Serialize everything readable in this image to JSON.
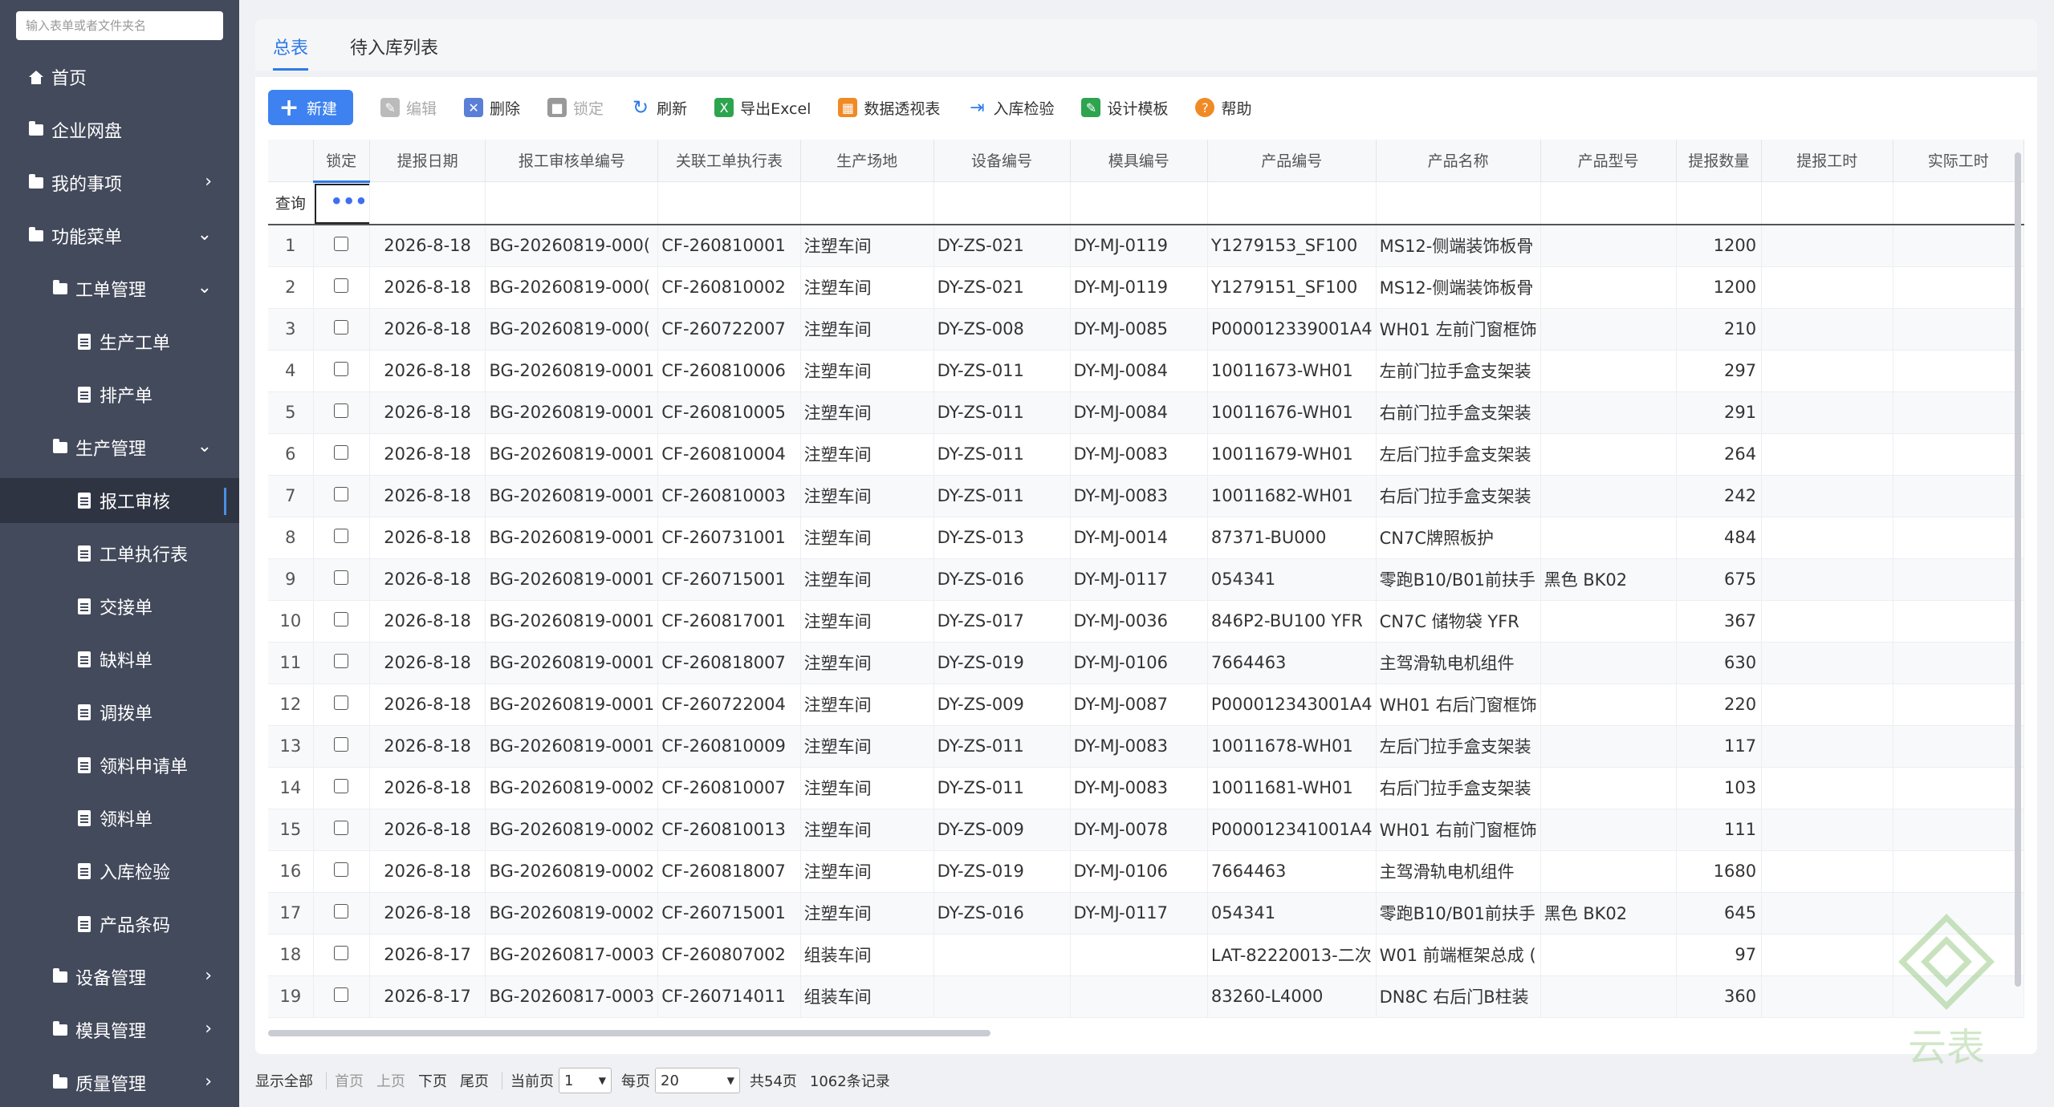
{
  "sidebar": {
    "search_placeholder": "输入表单或者文件夹名",
    "items": [
      {
        "label": "首页"
      },
      {
        "label": "企业网盘"
      },
      {
        "label": "我的事项"
      },
      {
        "label": "功能菜单"
      },
      {
        "label": "工单管理"
      },
      {
        "label": "生产工单"
      },
      {
        "label": "排产单"
      },
      {
        "label": "生产管理"
      },
      {
        "label": "报工审核"
      },
      {
        "label": "工单执行表"
      },
      {
        "label": "交接单"
      },
      {
        "label": "缺料单"
      },
      {
        "label": "调拨单"
      },
      {
        "label": "领料申请单"
      },
      {
        "label": "领料单"
      },
      {
        "label": "入库检验"
      },
      {
        "label": "产品条码"
      },
      {
        "label": "设备管理"
      },
      {
        "label": "模具管理"
      },
      {
        "label": "质量管理"
      }
    ]
  },
  "tabs": [
    {
      "label": "总表"
    },
    {
      "label": "待入库列表"
    }
  ],
  "toolbar": {
    "new": "新建",
    "edit": "编辑",
    "delete": "删除",
    "lock": "锁定",
    "refresh": "刷新",
    "export": "导出Excel",
    "pivot": "数据透视表",
    "inspect": "入库检验",
    "design": "设计模板",
    "help": "帮助"
  },
  "grid": {
    "query_label": "查询",
    "query_dots": "•••",
    "columns": [
      "锁定",
      "提报日期",
      "报工审核单编号",
      "关联工单执行表",
      "生产场地",
      "设备编号",
      "模具编号",
      "产品编号",
      "产品名称",
      "产品型号",
      "提报数量",
      "提报工时",
      "实际工时"
    ],
    "rows": [
      [
        "1",
        "2026-8-18",
        "BG-20260819-000(",
        "CF-260810001",
        "注塑车间",
        "DY-ZS-021",
        "DY-MJ-0119",
        "Y1279153_SF100",
        "MS12-侧端装饰板骨",
        "",
        "1200"
      ],
      [
        "2",
        "2026-8-18",
        "BG-20260819-000(",
        "CF-260810002",
        "注塑车间",
        "DY-ZS-021",
        "DY-MJ-0119",
        "Y1279151_SF100",
        "MS12-侧端装饰板骨",
        "",
        "1200"
      ],
      [
        "3",
        "2026-8-18",
        "BG-20260819-000(",
        "CF-260722007",
        "注塑车间",
        "DY-ZS-008",
        "DY-MJ-0085",
        "P000012339001A4",
        "WH01 左前门窗框饰",
        "",
        "210"
      ],
      [
        "4",
        "2026-8-18",
        "BG-20260819-0001",
        "CF-260810006",
        "注塑车间",
        "DY-ZS-011",
        "DY-MJ-0084",
        "10011673-WH01",
        "左前门拉手盒支架装",
        "",
        "297"
      ],
      [
        "5",
        "2026-8-18",
        "BG-20260819-0001",
        "CF-260810005",
        "注塑车间",
        "DY-ZS-011",
        "DY-MJ-0084",
        "10011676-WH01",
        "右前门拉手盒支架装",
        "",
        "291"
      ],
      [
        "6",
        "2026-8-18",
        "BG-20260819-0001",
        "CF-260810004",
        "注塑车间",
        "DY-ZS-011",
        "DY-MJ-0083",
        "10011679-WH01",
        "左后门拉手盒支架装",
        "",
        "264"
      ],
      [
        "7",
        "2026-8-18",
        "BG-20260819-0001",
        "CF-260810003",
        "注塑车间",
        "DY-ZS-011",
        "DY-MJ-0083",
        "10011682-WH01",
        "右后门拉手盒支架装",
        "",
        "242"
      ],
      [
        "8",
        "2026-8-18",
        "BG-20260819-0001",
        "CF-260731001",
        "注塑车间",
        "DY-ZS-013",
        "DY-MJ-0014",
        "87371-BU000",
        "CN7C牌照板护",
        "",
        "484"
      ],
      [
        "9",
        "2026-8-18",
        "BG-20260819-0001",
        "CF-260715001",
        "注塑车间",
        "DY-ZS-016",
        "DY-MJ-0117",
        "054341",
        "零跑B10/B01前扶手",
        "黑色 BK02",
        "675"
      ],
      [
        "10",
        "2026-8-18",
        "BG-20260819-0001",
        "CF-260817001",
        "注塑车间",
        "DY-ZS-017",
        "DY-MJ-0036",
        "846P2-BU100 YFR",
        "CN7C 储物袋 YFR",
        "",
        "367"
      ],
      [
        "11",
        "2026-8-18",
        "BG-20260819-0001",
        "CF-260818007",
        "注塑车间",
        "DY-ZS-019",
        "DY-MJ-0106",
        "7664463",
        "主驾滑轨电机组件",
        "",
        "630"
      ],
      [
        "12",
        "2026-8-18",
        "BG-20260819-0001",
        "CF-260722004",
        "注塑车间",
        "DY-ZS-009",
        "DY-MJ-0087",
        "P000012343001A4",
        "WH01 右后门窗框饰",
        "",
        "220"
      ],
      [
        "13",
        "2026-8-18",
        "BG-20260819-0001",
        "CF-260810009",
        "注塑车间",
        "DY-ZS-011",
        "DY-MJ-0083",
        "10011678-WH01",
        "左后门拉手盒支架装",
        "",
        "117"
      ],
      [
        "14",
        "2026-8-18",
        "BG-20260819-0002",
        "CF-260810007",
        "注塑车间",
        "DY-ZS-011",
        "DY-MJ-0083",
        "10011681-WH01",
        "右后门拉手盒支架装",
        "",
        "103"
      ],
      [
        "15",
        "2026-8-18",
        "BG-20260819-0002",
        "CF-260810013",
        "注塑车间",
        "DY-ZS-009",
        "DY-MJ-0078",
        "P000012341001A4",
        "WH01 右前门窗框饰",
        "",
        "111"
      ],
      [
        "16",
        "2026-8-18",
        "BG-20260819-0002",
        "CF-260818007",
        "注塑车间",
        "DY-ZS-019",
        "DY-MJ-0106",
        "7664463",
        "主驾滑轨电机组件",
        "",
        "1680"
      ],
      [
        "17",
        "2026-8-18",
        "BG-20260819-0002",
        "CF-260715001",
        "注塑车间",
        "DY-ZS-016",
        "DY-MJ-0117",
        "054341",
        "零跑B10/B01前扶手",
        "黑色 BK02",
        "645"
      ],
      [
        "18",
        "2026-8-17",
        "BG-20260817-0003",
        "CF-260807002",
        "组装车间",
        "",
        "",
        "LAT-82220013-二次",
        "W01 前端框架总成 (",
        "",
        "97"
      ],
      [
        "19",
        "2026-8-17",
        "BG-20260817-0003",
        "CF-260714011",
        "组装车间",
        "",
        "",
        "83260-L4000",
        "DN8C 右后门B柱装",
        "",
        "360"
      ]
    ]
  },
  "pager": {
    "show_all": "显示全部",
    "first": "首页",
    "prev": "上页",
    "next": "下页",
    "last": "尾页",
    "current_label": "当前页",
    "current_value": "1",
    "per_page_label": "每页",
    "per_page_value": "20",
    "total_pages": "共54页",
    "total_records": "1062条记录"
  },
  "watermark": {
    "text": "云表"
  },
  "colors": {
    "accent": "#3d82f0",
    "sidebar": "#434a5b"
  }
}
